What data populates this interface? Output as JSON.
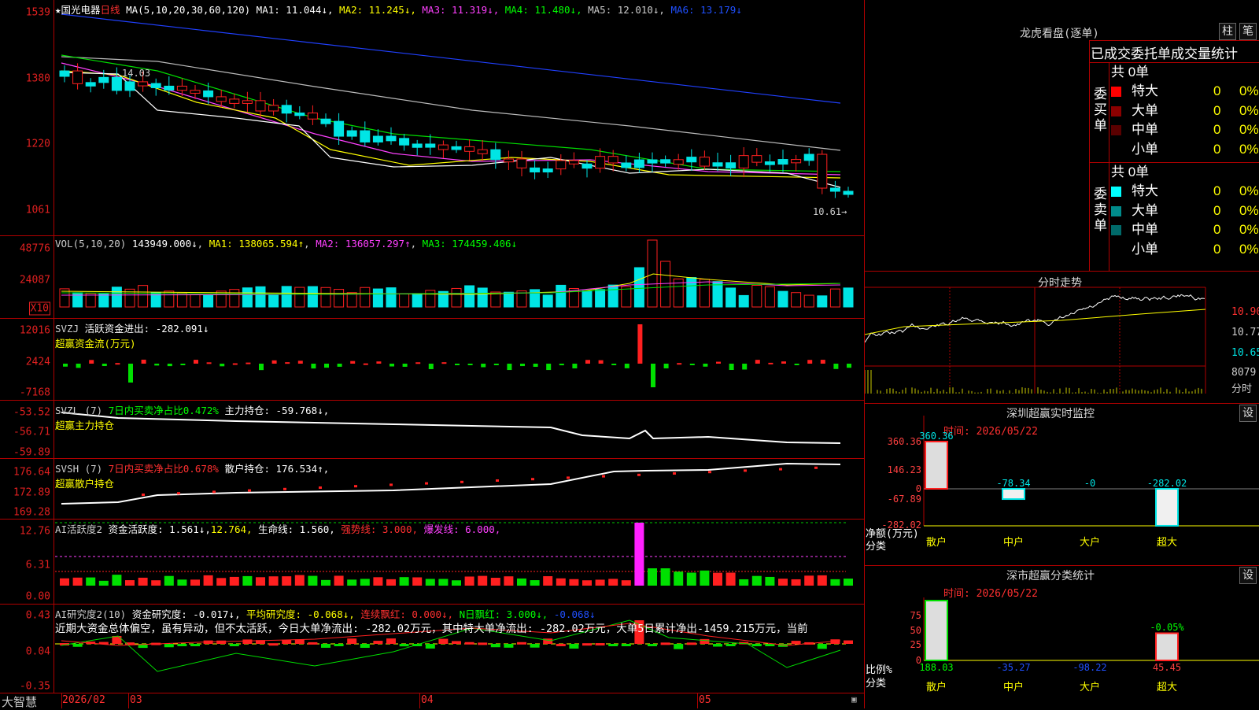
{
  "stock": {
    "name": "国光电器",
    "period": "日线",
    "ma_label": "MA(5,10,20,30,60,120)",
    "ma": [
      {
        "label": "MA1:",
        "value": "11.044",
        "arrow": "↓",
        "color": "#ffffff"
      },
      {
        "label": "MA2:",
        "value": "11.245",
        "arrow": "↓",
        "color": "#ffff00"
      },
      {
        "label": "MA3:",
        "value": "11.319",
        "arrow": "↓",
        "color": "#ff40ff"
      },
      {
        "label": "MA4:",
        "value": "11.480",
        "arrow": "↓",
        "color": "#00ff00"
      },
      {
        "label": "MA5:",
        "value": "12.010",
        "arrow": "↓",
        "color": "#cccccc"
      },
      {
        "label": "MA6:",
        "value": "13.179",
        "arrow": "↓",
        "color": "#2050ff"
      }
    ],
    "price_axis": [
      "1539",
      "1380",
      "1220",
      "1061"
    ],
    "high_marker": "14.03",
    "low_marker": "10.61→"
  },
  "vol": {
    "header": "VOL(5,10,20)",
    "value": "143949.000↓",
    "ma": [
      {
        "t": "MA1: 138065.594↑",
        "color": "#ffff00"
      },
      {
        "t": "MA2: 136057.297↑",
        "color": "#ff40ff"
      },
      {
        "t": "MA3: 174459.406↓",
        "color": "#00ff00"
      }
    ],
    "axis": [
      "48776",
      "24087"
    ],
    "unit": "X10"
  },
  "svzj": {
    "name": "SVZJ",
    "label": "活跃资金进出: -282.091↓",
    "sub": "超赢资金流(万元)",
    "axis": [
      "12016",
      "2424",
      "-7168"
    ]
  },
  "svzl": {
    "name": "SVZL (7)",
    "label1": "7日内买卖净占比0.472%",
    "label2": "主力持仓: -59.768↓,",
    "sub": "超赢主力持仓",
    "axis": [
      "-53.52",
      "-56.71",
      "-59.89"
    ]
  },
  "svsh": {
    "name": "SVSH (7)",
    "label1": "7日内买卖净占比0.678%",
    "label2": "散户持仓: 176.534↑,",
    "sub": "超赢散户持仓",
    "axis": [
      "176.64",
      "172.89",
      "169.28"
    ]
  },
  "ai1": {
    "name": "AI活跃度2",
    "p1": "资金活跃度: 1.561↓,",
    "p2": "12.764,",
    "p3": "生命线: 1.560,",
    "p4": "强势线: 3.000,",
    "p5": "爆发线: 6.000,",
    "axis": [
      "12.76",
      "6.31",
      "0.00"
    ]
  },
  "ai2": {
    "name": "AI研究度2(10)",
    "p1": "资金研究度: -0.017↓,",
    "p2": "平均研究度: -0.068↓,",
    "p3": "连续飘红: 0.000↓,",
    "p4": "N日飘红: 3.000↓,",
    "p5": "-0.068↓",
    "text": "近期大资金总体偏空，虽有异动，但不太活跃，今日大单净流出: -282.02万元，其中特大单净流出: -282.02万元，大单5日累计净出-1459.215万元，当前",
    "axis": [
      "0.43",
      "0.04",
      "-0.35"
    ]
  },
  "xaxis": {
    "brand": "大智慧",
    "labels": [
      "2026/02",
      "03",
      "04",
      "05"
    ]
  },
  "longhu": {
    "title": "龙虎看盘(逐单)",
    "btn1": "柱",
    "btn2": "笔",
    "subtitle": "已成交委托单成交量统计",
    "buy": {
      "side": "委买单",
      "total": "共 0单",
      "rows": [
        {
          "n": "特大",
          "v": "0",
          "p": "0%",
          "c": "#ff0000"
        },
        {
          "n": "大单",
          "v": "0",
          "p": "0%",
          "c": "#8b0000"
        },
        {
          "n": "中单",
          "v": "0",
          "p": "0%",
          "c": "#5a0000"
        },
        {
          "n": "小单",
          "v": "0",
          "p": "0%",
          "c": ""
        }
      ]
    },
    "sell": {
      "side": "委卖单",
      "total": "共 0单",
      "rows": [
        {
          "n": "特大",
          "v": "0",
          "p": "0%",
          "c": "#00ffff"
        },
        {
          "n": "大单",
          "v": "0",
          "p": "0%",
          "c": "#008b8b"
        },
        {
          "n": "中单",
          "v": "0",
          "p": "0%",
          "c": "#006a6a"
        },
        {
          "n": "小单",
          "v": "0",
          "p": "0%",
          "c": ""
        }
      ]
    }
  },
  "intraday": {
    "title": "分时走势",
    "axis": [
      "10.90",
      "10.77",
      "10.65"
    ],
    "vol_max": "8079",
    "vol_unit": "分时"
  },
  "monitor": {
    "title": "深圳超赢实时监控",
    "btn": "设",
    "time": "时间: 2026/05/22",
    "axis": [
      "360.36",
      "146.23",
      "0",
      "-67.89",
      "-282.02"
    ],
    "ylabel": "净额(万元)",
    "xlabel": "分类",
    "cats": [
      "散户",
      "中户",
      "大户",
      "超大"
    ],
    "values": [
      "360.36",
      "-78.34",
      "-0",
      "-282.02"
    ]
  },
  "stats": {
    "title": "深市超赢分类统计",
    "btn": "设",
    "time": "时间: 2026/05/22",
    "axis": [
      "75",
      "50",
      "25",
      "0"
    ],
    "ylabel": "比例%",
    "xlabel": "分类",
    "cats": [
      "散户",
      "中户",
      "大户",
      "超大"
    ],
    "values": [
      "188.03",
      "-35.27",
      "-98.22",
      "45.45"
    ],
    "top_val": "-0.05%"
  }
}
